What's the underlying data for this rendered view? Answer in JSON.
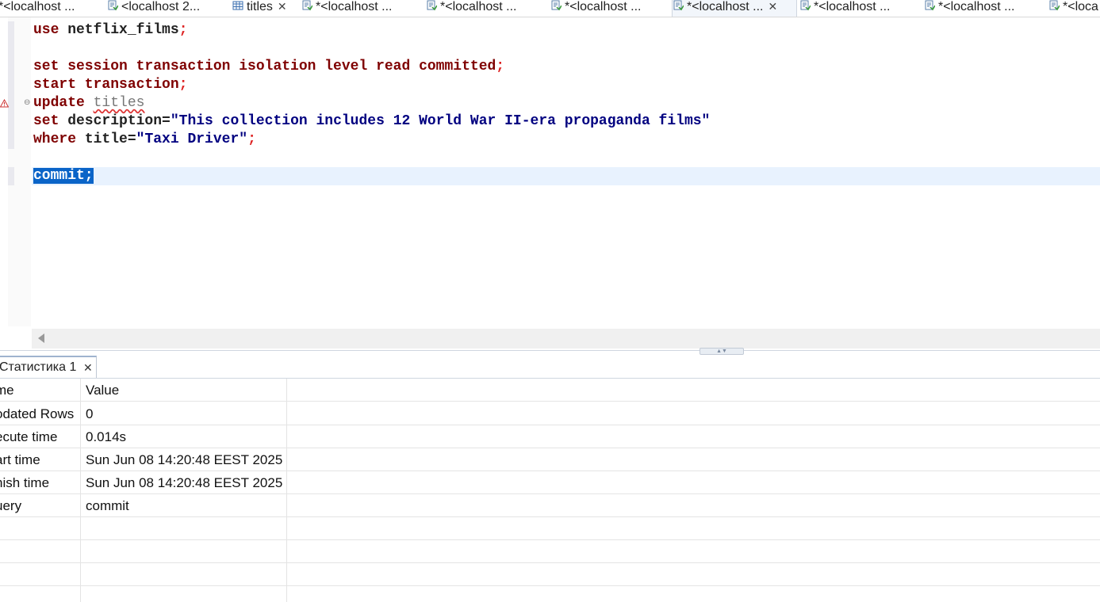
{
  "tabs": [
    {
      "label": "*<localhost ...",
      "icon": "sql-editor-icon",
      "active": false,
      "closable": false
    },
    {
      "label": "<localhost 2...",
      "icon": "sql-editor-icon",
      "active": false,
      "closable": false
    },
    {
      "label": "titles",
      "icon": "table-icon",
      "active": false,
      "closable": true
    },
    {
      "label": "*<localhost ...",
      "icon": "sql-editor-icon",
      "active": false,
      "closable": false
    },
    {
      "label": "*<localhost ...",
      "icon": "sql-editor-icon",
      "active": false,
      "closable": false
    },
    {
      "label": "*<localhost ...",
      "icon": "sql-editor-icon",
      "active": false,
      "closable": false
    },
    {
      "label": "*<localhost ...",
      "icon": "sql-editor-icon",
      "active": true,
      "closable": true
    },
    {
      "label": "*<localhost ...",
      "icon": "sql-editor-icon",
      "active": false,
      "closable": false
    },
    {
      "label": "*<localhost ...",
      "icon": "sql-editor-icon",
      "active": false,
      "closable": false
    },
    {
      "label": "*<loca",
      "icon": "sql-editor-icon",
      "active": false,
      "closable": false
    }
  ],
  "editor": {
    "line1": {
      "kw": "use",
      "rest": " netflix_films",
      "semi": ";"
    },
    "line3": {
      "kw": "set session transaction isolation level read committed",
      "semi": ";"
    },
    "line4": {
      "kw": "start transaction",
      "semi": ";"
    },
    "line5": {
      "kw": "update",
      "sp": " ",
      "table": "titles"
    },
    "line6": {
      "kw": "set",
      "plain": " description=",
      "str": "\"This collection includes 12 World War II-era propaganda films\""
    },
    "line7": {
      "kw": "where",
      "plain": " title=",
      "str": "\"Taxi Driver\"",
      "semi": ";"
    },
    "line9": {
      "selected": "commit;"
    }
  },
  "results": {
    "tab_label": "Статистика 1",
    "close_glyph": "✕",
    "headers": {
      "name": "me",
      "value": "Value"
    },
    "rows": [
      {
        "name": "odated Rows",
        "value": "0"
      },
      {
        "name": "ecute time",
        "value": "0.014s"
      },
      {
        "name": "art time",
        "value": "Sun Jun 08 14:20:48 EEST 2025"
      },
      {
        "name": "nish time",
        "value": "Sun Jun 08 14:20:48 EEST 2025"
      },
      {
        "name": "uery",
        "value": "commit"
      }
    ]
  },
  "colors": {
    "keyword": "#7f0000",
    "string": "#000080",
    "selection": "#0a64c8",
    "current_line": "#e8f2fe"
  }
}
